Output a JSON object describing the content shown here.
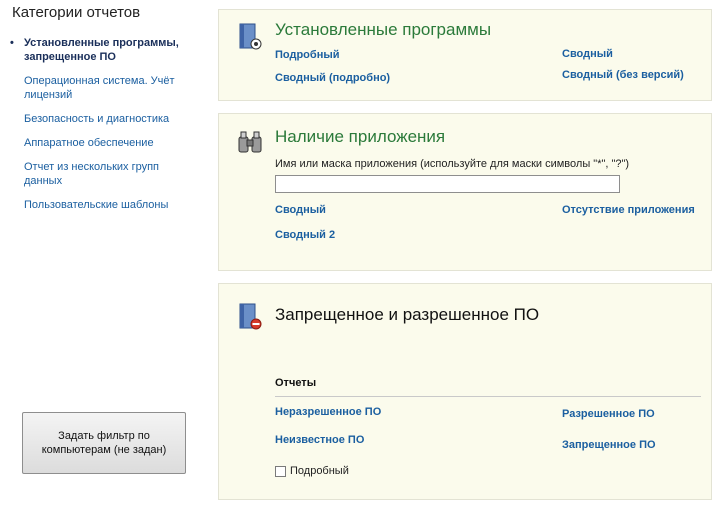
{
  "sidebar": {
    "title": "Категории отчетов",
    "items": [
      {
        "label": "Установленные программы, запрещенное ПО",
        "active": true
      },
      {
        "label": "Операционная система. Учёт лицензий"
      },
      {
        "label": "Безопасность и диагностика"
      },
      {
        "label": "Аппаратное обеспечение"
      },
      {
        "label": "Отчет из нескольких групп данных"
      },
      {
        "label": "Пользовательские шаблоны"
      }
    ],
    "filter_button": "Задать фильтр по компьютерам (не задан)"
  },
  "panels": {
    "installed": {
      "title": "Установленные программы",
      "links": {
        "detailed": "Подробный",
        "summary_detailed": "Сводный (подробно)",
        "summary": "Сводный",
        "summary_no_versions": "Сводный (без версий)"
      }
    },
    "app_presence": {
      "title": "Наличие приложения",
      "input_label": "Имя или маска приложения (используйте для маски символы \"*\", \"?\")",
      "input_value": "",
      "links": {
        "summary": "Сводный",
        "summary2": "Сводный 2",
        "absence": "Отсутствие приложения"
      }
    },
    "software_policy": {
      "title": "Запрещенное и разрешенное ПО",
      "reports_label": "Отчеты",
      "links": {
        "unauthorized": "Неразрешенное ПО",
        "unknown": "Неизвестное ПО",
        "authorized": "Разрешенное ПО",
        "forbidden": "Запрещенное ПО"
      },
      "checkbox_label": "Подробный",
      "checkbox_checked": false
    }
  },
  "icons": {
    "installed": "installed-programs-icon",
    "app_presence": "binoculars-icon",
    "software_policy": "forbidden-software-icon"
  },
  "colors": {
    "link": "#1b5fa0",
    "panel_title": "#2b7a3a",
    "panel_bg": "#fbfbec"
  }
}
